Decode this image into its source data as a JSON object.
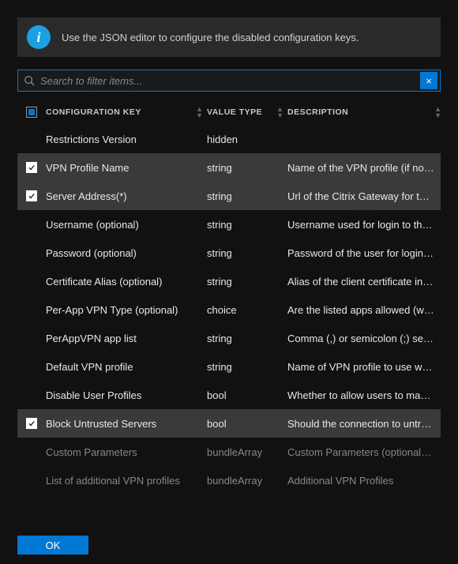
{
  "info_message": "Use the JSON editor to configure the disabled configuration keys.",
  "search": {
    "placeholder": "Search to filter items...",
    "value": ""
  },
  "columns": {
    "key_header": "CONFIGURATION KEY",
    "type_header": "VALUE TYPE",
    "desc_header": "DESCRIPTION"
  },
  "rows": [
    {
      "key": "Restrictions Version",
      "type": "hidden",
      "desc": "",
      "selected": false,
      "disabled": false
    },
    {
      "key": "VPN Profile Name",
      "type": "string",
      "desc": "Name of the VPN profile (if not set, server address is used as profile name)",
      "selected": true,
      "disabled": false
    },
    {
      "key": "Server Address(*)",
      "type": "string",
      "desc": "Url of the Citrix Gateway for the VPN profile",
      "selected": true,
      "disabled": false
    },
    {
      "key": "Username (optional)",
      "type": "string",
      "desc": "Username used for login to the gateway",
      "selected": false,
      "disabled": false
    },
    {
      "key": "Password (optional)",
      "type": "string",
      "desc": "Password of the user for login to the gateway",
      "selected": false,
      "disabled": false
    },
    {
      "key": "Certificate Alias (optional)",
      "type": "string",
      "desc": "Alias of the client certificate installed on the device",
      "selected": false,
      "disabled": false
    },
    {
      "key": "Per-App VPN Type (optional)",
      "type": "choice",
      "desc": "Are the listed apps allowed (whitelist) or disallowed (blacklist)",
      "selected": false,
      "disabled": false
    },
    {
      "key": "PerAppVPN app list",
      "type": "string",
      "desc": "Comma (,) or semicolon (;) separated list of apps",
      "selected": false,
      "disabled": false
    },
    {
      "key": "Default VPN profile",
      "type": "string",
      "desc": "Name of VPN profile to use when always-on is enabled",
      "selected": false,
      "disabled": false
    },
    {
      "key": "Disable User Profiles",
      "type": "bool",
      "desc": "Whether to allow users to manually add profiles",
      "selected": false,
      "disabled": false
    },
    {
      "key": "Block Untrusted Servers",
      "type": "bool",
      "desc": "Should the connection to untrusted servers be blocked",
      "selected": true,
      "disabled": false
    },
    {
      "key": "Custom Parameters",
      "type": "bundleArray",
      "desc": "Custom Parameters (optional). Additional parameter list",
      "selected": false,
      "disabled": true
    },
    {
      "key": "List of additional VPN profiles",
      "type": "bundleArray",
      "desc": "Additional VPN Profiles",
      "selected": false,
      "disabled": true
    }
  ],
  "buttons": {
    "ok": "OK"
  }
}
